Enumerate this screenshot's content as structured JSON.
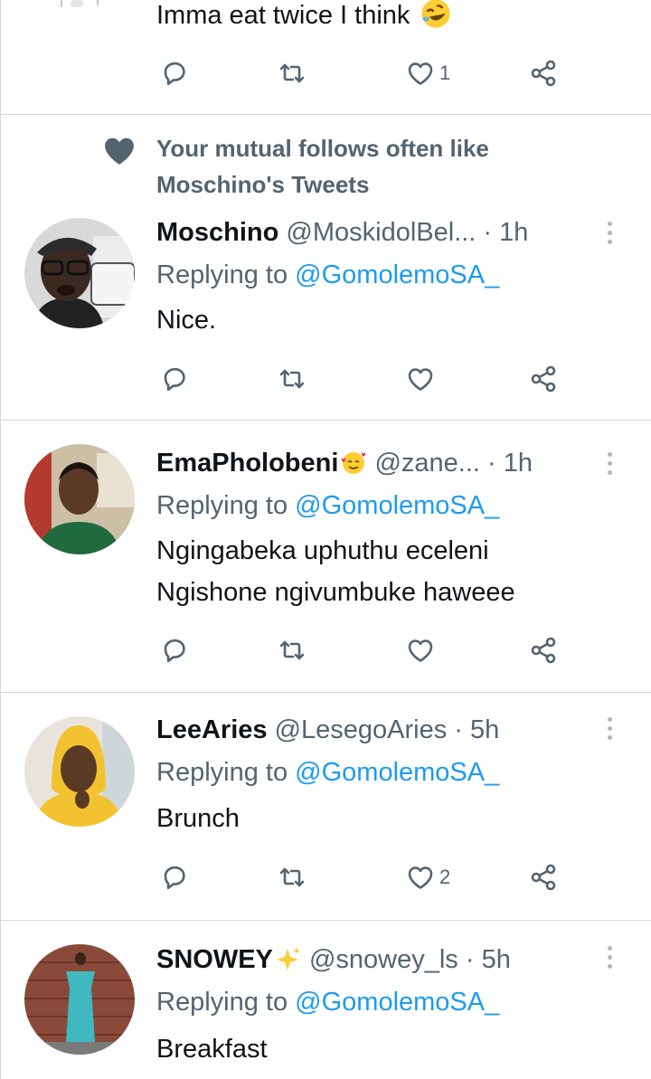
{
  "tweets": [
    {
      "text": "Imma eat twice I think",
      "emoji": "rolling-on-floor-laughing-emoji",
      "likes": "1"
    },
    {
      "social_context": [
        "Your mutual follows often like",
        "Moschino's Tweets"
      ],
      "name": "Moschino",
      "handle": "@MoskidolBel...",
      "time": "· 1h",
      "replying_to_label": "Replying to",
      "replying_to": "@GomolemoSA_",
      "text": "Nice."
    },
    {
      "name": "EmaPholobeni",
      "name_emoji": "smiling-face-with-hearts-emoji",
      "handle": "@zane...",
      "time": "· 1h",
      "replying_to_label": "Replying to",
      "replying_to": "@GomolemoSA_",
      "text_lines": [
        "Ngingabeka uphuthu eceleni",
        "Ngishone ngivumbuke haweee"
      ]
    },
    {
      "name": "LeeAries",
      "handle": "@LesegoAries",
      "time": "· 5h",
      "replying_to_label": "Replying to",
      "replying_to": "@GomolemoSA_",
      "text": "Brunch",
      "likes": "2"
    },
    {
      "name": "SNOWEY",
      "name_emoji": "sparkles-emoji",
      "handle": "@snowey_ls",
      "time": "· 5h",
      "replying_to_label": "Replying to",
      "replying_to": "@GomolemoSA_",
      "text": "Breakfast"
    }
  ],
  "colors": {
    "link": "#1d9bf0",
    "secondary_text": "#536471",
    "divider": "#cfd9de"
  }
}
